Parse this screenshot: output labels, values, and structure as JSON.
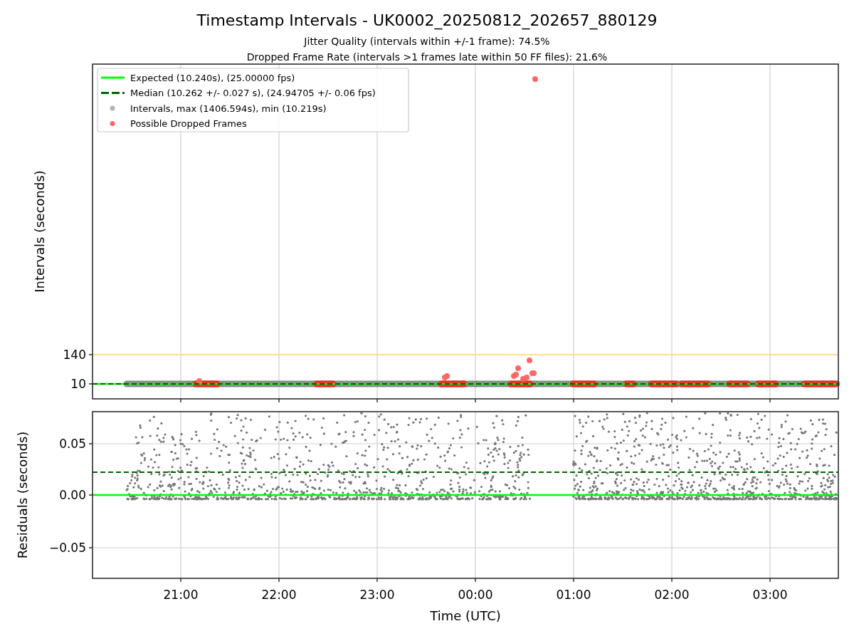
{
  "figure": {
    "title": "Timestamp Intervals - UK0002_20250812_202657_880129",
    "subtitle_lines": [
      "Jitter Quality (intervals within +/-1 frame): 74.5%",
      "Dropped Frame Rate (intervals >1 frames late within 50 FF files): 21.6%"
    ]
  },
  "intervals_panel": {
    "y_label": "Intervals (seconds)",
    "y_ticks": [
      "140",
      "10"
    ],
    "legend": [
      {
        "kind": "solid-line",
        "label": "Expected (10.240s), (25.00000 fps)",
        "color": "#00ff00"
      },
      {
        "kind": "dashed-line",
        "label": "Median (10.262 +/- 0.027 s), (24.94705 +/- 0.06 fps)",
        "color": "#006400"
      },
      {
        "kind": "dot",
        "label": "Intervals, max (1406.594s), min (10.219s)",
        "color": "#b3b3b3"
      },
      {
        "kind": "dot",
        "label": "Possible Dropped Frames",
        "color": "#ff6666"
      }
    ]
  },
  "residuals_panel": {
    "y_label": "Residuals (seconds)",
    "y_ticks": [
      "0.05",
      "0.00",
      "−0.05"
    ]
  },
  "x_axis": {
    "label": "Time (UTC)",
    "ticks": [
      "21:00",
      "22:00",
      "23:00",
      "00:00",
      "01:00",
      "02:00",
      "03:00"
    ]
  }
}
